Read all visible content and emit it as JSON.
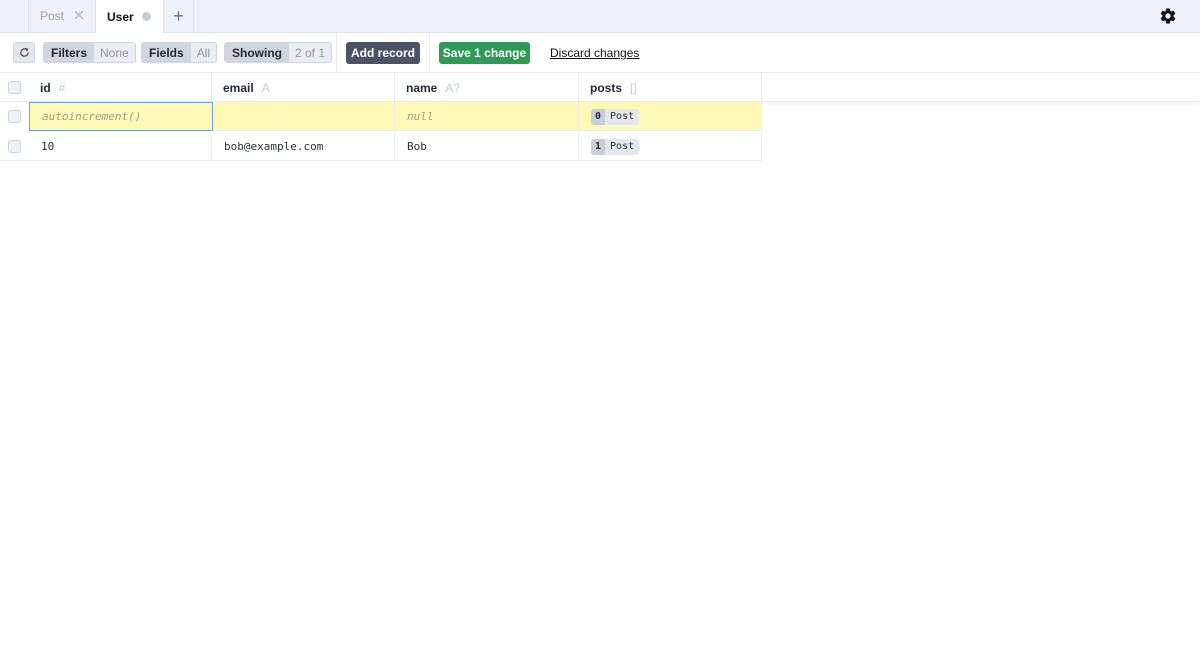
{
  "tabs": [
    {
      "label": "Post",
      "state": "closable"
    },
    {
      "label": "User",
      "state": "active-unsaved"
    }
  ],
  "icons": {
    "add_tab": "+",
    "settings": "gear-icon",
    "refresh": "refresh-icon",
    "close": "close-icon"
  },
  "toolbar": {
    "filters_label": "Filters",
    "filters_value": "None",
    "fields_label": "Fields",
    "fields_value": "All",
    "showing_label": "Showing",
    "showing_value": "2 of 1",
    "add_record": "Add record",
    "save_changes": "Save 1 change",
    "discard_changes": "Discard changes"
  },
  "columns": [
    {
      "name": "id",
      "type": "#"
    },
    {
      "name": "email",
      "type": "A"
    },
    {
      "name": "name",
      "type": "A?"
    },
    {
      "name": "posts",
      "type": "[]"
    }
  ],
  "rows": [
    {
      "id": "autoincrement()",
      "email": "",
      "name": "null",
      "posts_count": "0",
      "posts_model": "Post",
      "new": true
    },
    {
      "id": "10",
      "email": "bob@example.com",
      "name": "Bob",
      "posts_count": "1",
      "posts_model": "Post",
      "new": false
    }
  ],
  "colors": {
    "save": "#2f9a55",
    "add": "#4a5462",
    "new_row": "#fff9b8",
    "focus": "#6aa3d6"
  }
}
